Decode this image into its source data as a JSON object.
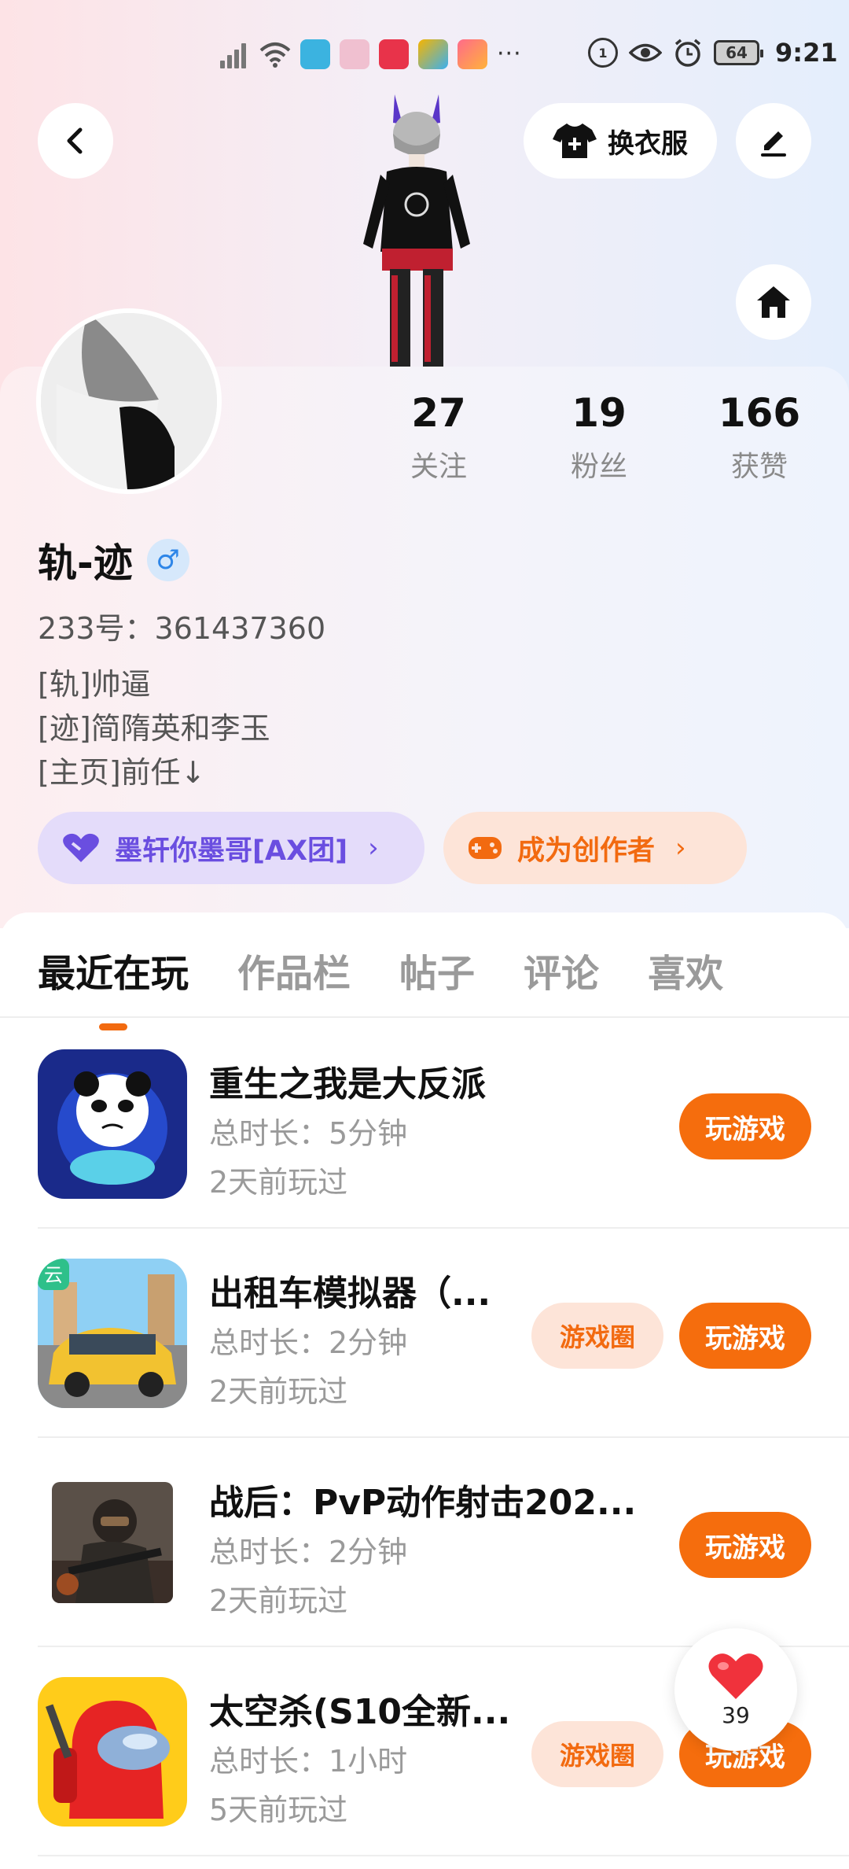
{
  "status_bar": {
    "time": "9:21",
    "battery": "64",
    "network_badge": "1"
  },
  "header": {
    "dress_label": "换衣服"
  },
  "profile": {
    "stats": [
      {
        "value": "27",
        "label": "关注"
      },
      {
        "value": "19",
        "label": "粉丝"
      },
      {
        "value": "166",
        "label": "获赞"
      }
    ],
    "name": "轨-迹",
    "gender_symbol": "♂",
    "id_text": "233号：361437360",
    "bio": [
      "[轨]帅逼",
      "[迹]简隋英和李玉",
      "[主页]前任↓"
    ],
    "team_pill": "墨轩你墨哥[AX团]",
    "creator_pill": "成为创作者"
  },
  "tabs": [
    "最近在玩",
    "作品栏",
    "帖子",
    "评论",
    "喜欢"
  ],
  "games": [
    {
      "title": "重生之我是大反派",
      "duration": "总时长：5分钟",
      "last_played": "2天前玩过",
      "has_circle": false
    },
    {
      "title": "出租车模拟器（...",
      "duration": "总时长：2分钟",
      "last_played": "2天前玩过",
      "has_circle": true,
      "badge": "云"
    },
    {
      "title": "战后：PvP动作射击202...",
      "duration": "总时长：2分钟",
      "last_played": "2天前玩过",
      "has_circle": false
    },
    {
      "title": "太空杀(S10全新...",
      "duration": "总时长：1小时",
      "last_played": "5天前玩过",
      "has_circle": true
    }
  ],
  "buttons": {
    "play": "玩游戏",
    "circle": "游戏圈"
  },
  "like_count": "39",
  "colors": {
    "accent": "#f56d0d",
    "team": "#6a4ee0",
    "gender": "#2e86e8"
  }
}
